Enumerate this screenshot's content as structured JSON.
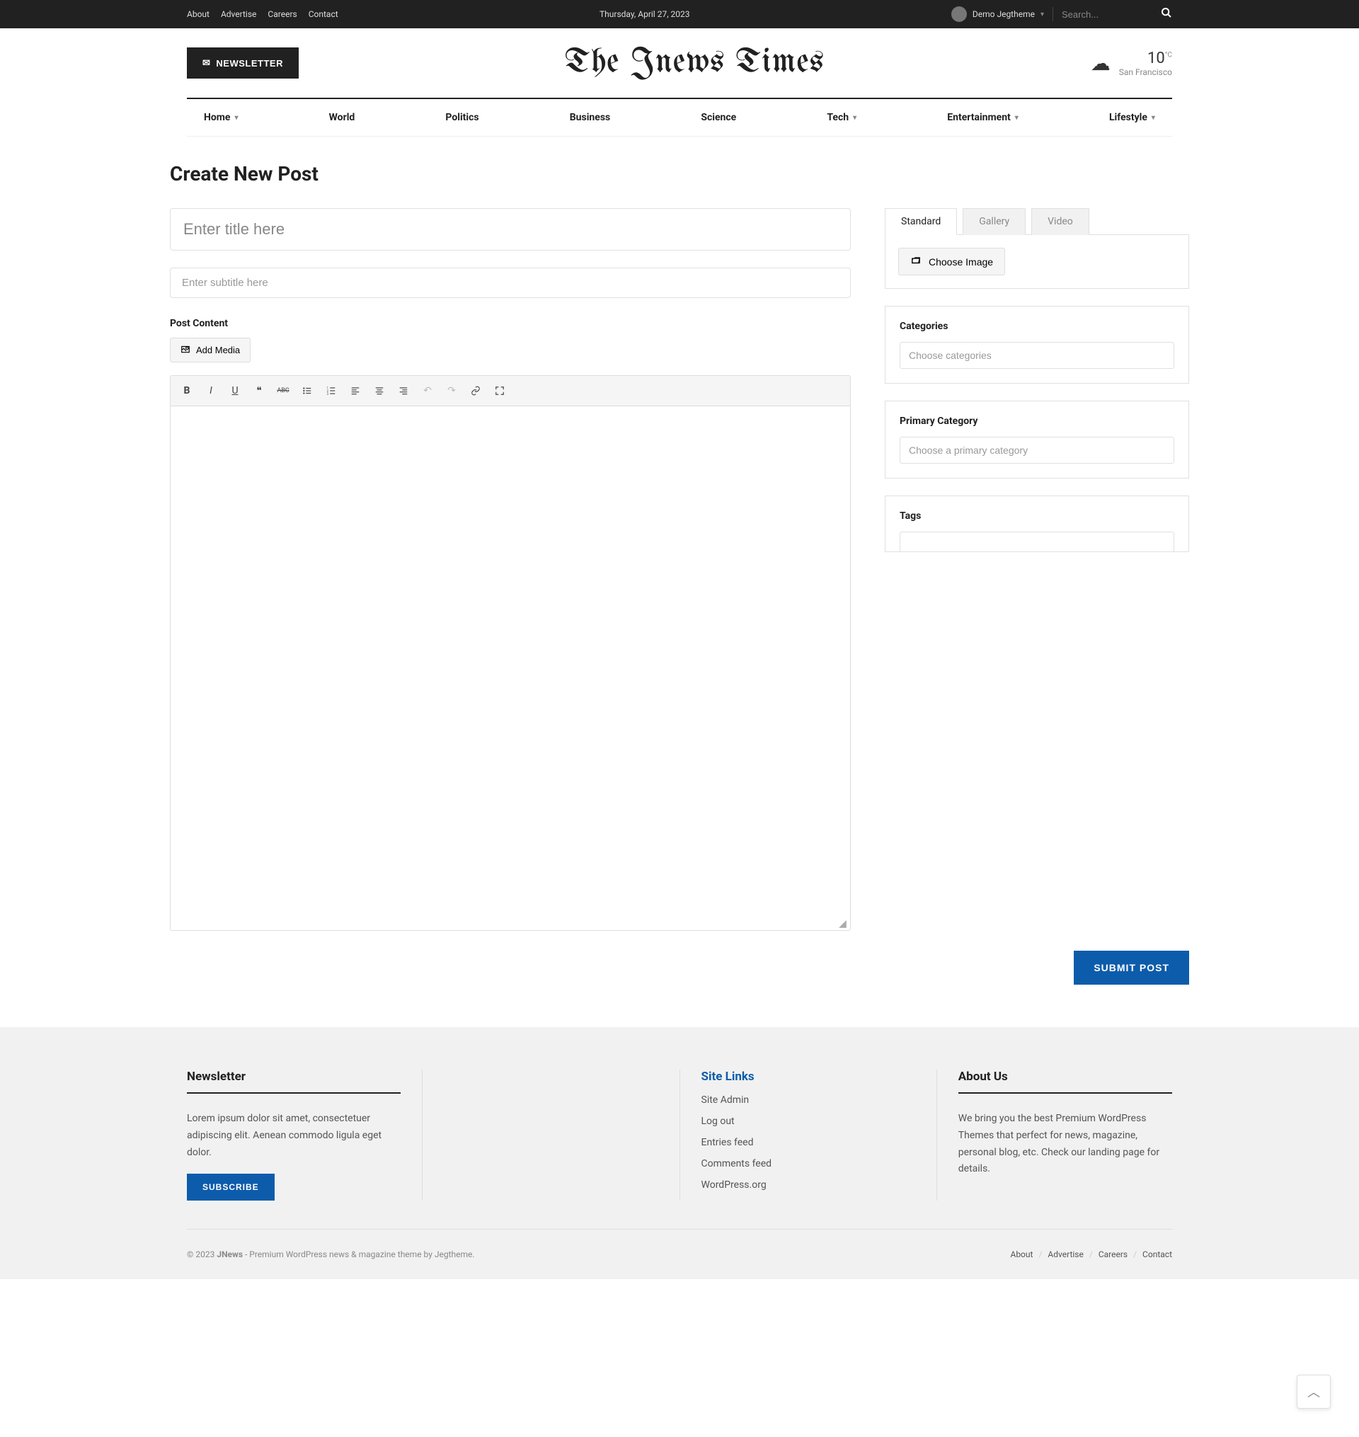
{
  "topbar": {
    "links": [
      "About",
      "Advertise",
      "Careers",
      "Contact"
    ],
    "date": "Thursday, April 27, 2023",
    "user": "Demo Jegtheme",
    "search_placeholder": "Search..."
  },
  "header": {
    "newsletter": "NEWSLETTER",
    "logo": "The Jnews Times",
    "weather": {
      "temp": "10",
      "unit": "°C",
      "location": "San Francisco"
    }
  },
  "nav": [
    {
      "label": "Home",
      "dropdown": true
    },
    {
      "label": "World",
      "dropdown": false
    },
    {
      "label": "Politics",
      "dropdown": false
    },
    {
      "label": "Business",
      "dropdown": false
    },
    {
      "label": "Science",
      "dropdown": false
    },
    {
      "label": "Tech",
      "dropdown": true
    },
    {
      "label": "Entertainment",
      "dropdown": true
    },
    {
      "label": "Lifestyle",
      "dropdown": true
    }
  ],
  "page": {
    "title": "Create New Post",
    "title_placeholder": "Enter title here",
    "subtitle_placeholder": "Enter subtitle here",
    "content_label": "Post Content",
    "add_media": "Add Media",
    "submit": "SUBMIT POST"
  },
  "sidebar": {
    "tabs": [
      "Standard",
      "Gallery",
      "Video"
    ],
    "choose_image": "Choose Image",
    "categories": {
      "title": "Categories",
      "placeholder": "Choose categories"
    },
    "primary": {
      "title": "Primary Category",
      "placeholder": "Choose a primary category"
    },
    "tags": {
      "title": "Tags"
    }
  },
  "footer": {
    "newsletter": {
      "title": "Newsletter",
      "text": "Lorem ipsum dolor sit amet, consectetuer adipiscing elit. Aenean commodo ligula eget dolor.",
      "button": "SUBSCRIBE"
    },
    "sitelinks": {
      "title": "Site Links",
      "links": [
        "Site Admin",
        "Log out",
        "Entries feed",
        "Comments feed",
        "WordPress.org"
      ]
    },
    "about": {
      "title": "About Us",
      "text": "We bring you the best Premium WordPress Themes that perfect for news, magazine, personal blog, etc. Check our landing page for details."
    },
    "bottom": {
      "copyright_prefix": "© 2023 ",
      "brand": "JNews",
      "suffix": " - Premium WordPress news & magazine theme by ",
      "theme": "Jegtheme",
      "links": [
        "About",
        "Advertise",
        "Careers",
        "Contact"
      ]
    }
  }
}
